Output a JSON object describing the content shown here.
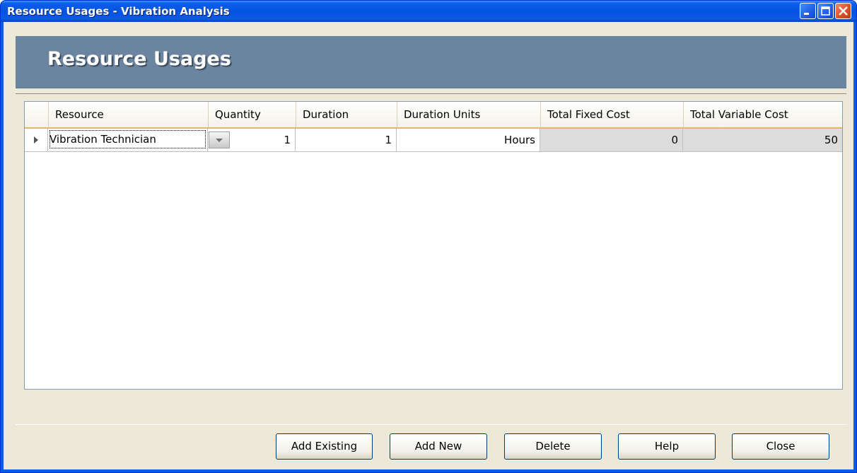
{
  "window": {
    "title": "Resource Usages - Vibration Analysis"
  },
  "banner": {
    "title": "Resource Usages"
  },
  "grid": {
    "columns": [
      "Resource",
      "Quantity",
      "Duration",
      "Duration Units",
      "Total Fixed Cost",
      "Total Variable Cost"
    ],
    "rows": [
      {
        "resource": "Vibration Technician",
        "quantity": "1",
        "duration": "1",
        "duration_units": "Hours",
        "total_fixed_cost": "0",
        "total_variable_cost": "50"
      }
    ]
  },
  "buttons": {
    "add_existing": "Add Existing",
    "add_new": "Add New",
    "delete": "Delete",
    "help": "Help",
    "close": "Close"
  },
  "colors": {
    "titlebar": "#0553e1",
    "banner": "#6b85a0",
    "client": "#ece9d8",
    "readonly_cell": "#dcdcdc"
  },
  "icons": {
    "minimize": "minimize-icon",
    "maximize": "maximize-icon",
    "close": "close-icon",
    "row_indicator": "row-indicator-icon",
    "dropdown": "chevron-down-icon"
  }
}
